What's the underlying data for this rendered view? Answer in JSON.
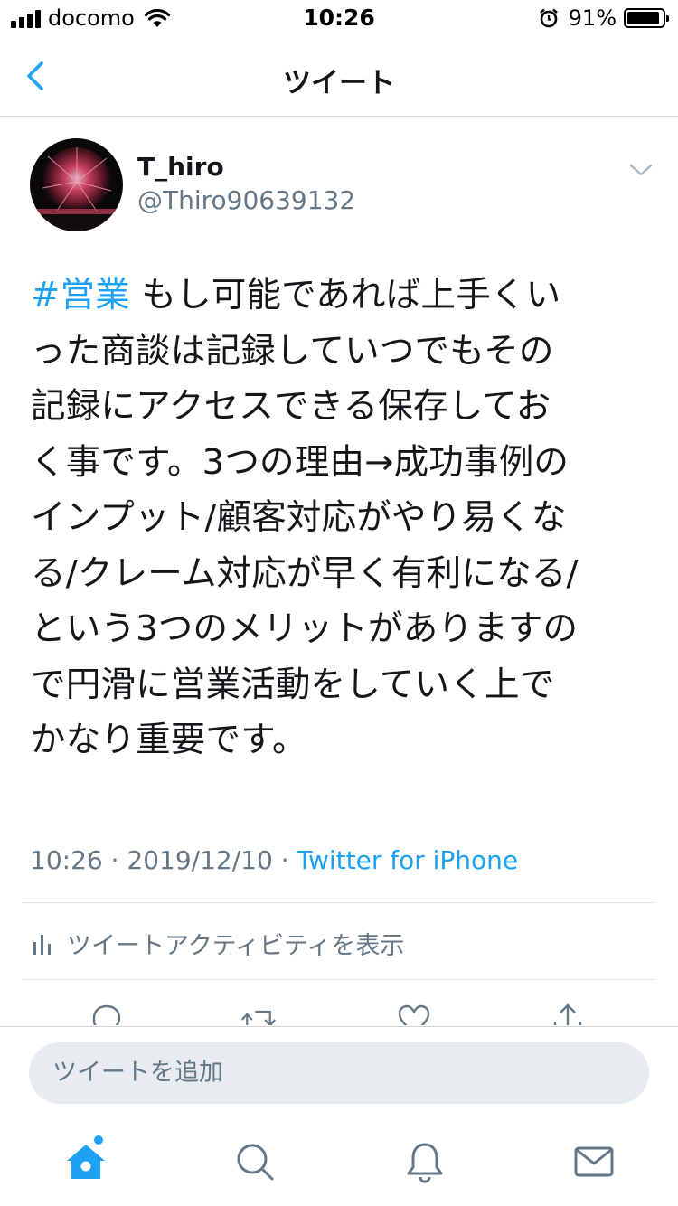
{
  "status_bar": {
    "carrier": "docomo",
    "time": "10:26",
    "battery_percent": "91%",
    "battery_level": 0.91,
    "icons": [
      "signal-icon",
      "wifi-icon",
      "alarm-icon",
      "battery-icon"
    ]
  },
  "nav": {
    "title": "ツイート",
    "back_icon": "chevron-left-icon"
  },
  "tweet": {
    "author_name": "T_hiro",
    "author_handle": "@Thiro90639132",
    "hashtag": "#営業",
    "lines": [
      " もし可能であれば上手くい",
      "った商談は記録していつでもその",
      "記録にアクセスできる保存してお",
      "く事です。3つの理由→成功事例の",
      "インプット/顧客対応がやり易くな",
      "る/クレーム対応が早く有利になる/",
      "という3つのメリットがありますの",
      "で円滑に営業活動をしていく上で",
      "かなり重要です。"
    ],
    "time": "10:26",
    "date": "2019/12/10",
    "separator": " · ",
    "source": "Twitter for iPhone",
    "activity_label": "ツイートアクティビティを表示"
  },
  "actions": [
    "reply-icon",
    "retweet-icon",
    "like-icon",
    "share-icon"
  ],
  "composer": {
    "placeholder": "ツイートを追加"
  },
  "tabs": [
    "home-icon",
    "search-icon",
    "notifications-icon",
    "messages-icon"
  ],
  "colors": {
    "accent": "#1da1f2",
    "text": "#14171a",
    "secondary": "#657786",
    "divider": "#e1e8ed",
    "input_bg": "#e6ecf0"
  }
}
